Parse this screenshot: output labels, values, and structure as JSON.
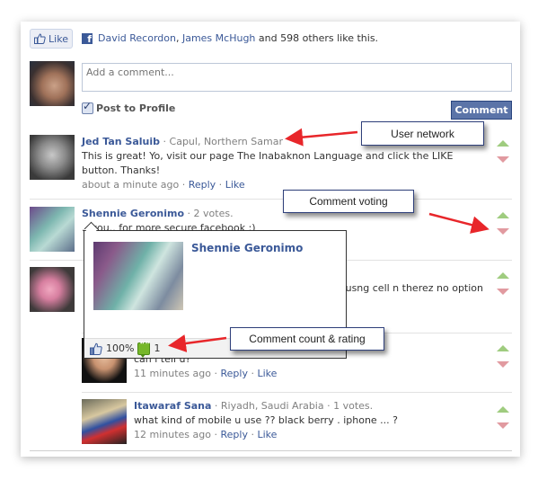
{
  "like_bar": {
    "like_button_label": "Like",
    "friend_1": "David Recordon",
    "separator": ", ",
    "friend_2": "James McHugh",
    "suffix": " and 598 others like this."
  },
  "composer": {
    "placeholder": "Add a comment...",
    "post_to_profile_label": "Post to Profile",
    "post_to_profile_checked": true,
    "comment_button_label": "Comment"
  },
  "comments": [
    {
      "author": "Jed Tan Saluib",
      "meta": " · Capul, Northern Samar",
      "text": "This is great! Yo, visit our page The Inabaknon Language and click the LIKE button. Thanks!",
      "time": "about a minute ago",
      "reply_label": "Reply",
      "like_label": "Like"
    },
    {
      "author": "Shennie Geronimo",
      "meta": " · 2 votes.",
      "text": "...you.. for more secure facebook :)"
    },
    {
      "author": "",
      "meta": "",
      "text": "...usng cell n therez no option"
    },
    {
      "author": "",
      "meta": "",
      "text": "can i tell u?",
      "time": "11 minutes ago",
      "reply_label": "Reply",
      "like_label": "Like"
    },
    {
      "author": "Itawaraf Sana",
      "meta": " · Riyadh, Saudi Arabia · 1 votes.",
      "text": "what kind of mobile u use ?? black berry . iphone ... ?",
      "time": "12 minutes ago",
      "reply_label": "Reply",
      "like_label": "Like"
    }
  ],
  "dot": " · ",
  "profile_popup": {
    "name": "Shennie Geronimo",
    "rating": "100%",
    "comment_count": "1"
  },
  "callouts": {
    "user_network": "User network",
    "comment_voting": "Comment voting",
    "comment_count_rating": "Comment count & rating"
  },
  "colors": {
    "link": "#3b5998",
    "vote_up": "#9fcc7f",
    "vote_down": "#e19aa0",
    "annotation_arrow": "#e8262a"
  }
}
